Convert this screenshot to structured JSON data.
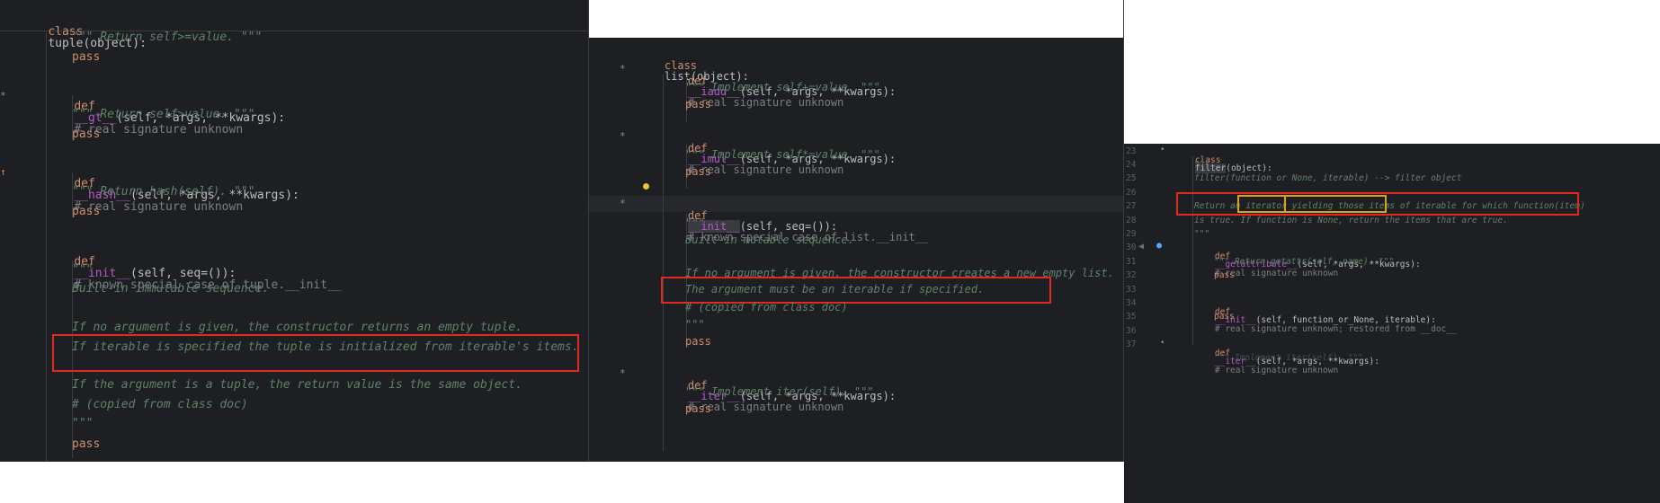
{
  "tuple_pane": {
    "lines": [
      {
        "k": "class",
        "n": "tuple",
        "r": "(object):"
      },
      {
        "doc": "\"\"\" Return self>=value. \"\"\""
      },
      {
        "pass": "pass"
      },
      {
        "def": "def",
        "name": "__gt__",
        "params": "(self, *args, **kwargs):",
        "comment": "# real signature unknown"
      },
      {
        "doc": "\"\"\" Return self>value. \"\"\""
      },
      {
        "pass": "pass"
      },
      {
        "def": "def",
        "name": "__hash__",
        "params": "(self, *args, **kwargs):",
        "comment": "# real signature unknown"
      },
      {
        "doc": "\"\"\" Return hash(self). \"\"\""
      },
      {
        "pass": "pass"
      },
      {
        "def": "def",
        "name": "__init__",
        "params": "(self, seq=()):",
        "comment": "# known special case of tuple.__init__"
      },
      {
        "doc": "\"\"\""
      },
      {
        "doc": "Built-in immutable sequence."
      },
      {
        "doc": "If no argument is given, the constructor returns an empty tuple."
      },
      {
        "doc": "If iterable is specified the tuple is initialized from iterable's items."
      },
      {
        "doc": "If the argument is a tuple, the return value is the same object."
      },
      {
        "doc": "# (copied from class doc)"
      },
      {
        "doc": "\"\"\""
      },
      {
        "pass": "pass"
      }
    ]
  },
  "list_pane": {
    "header": {
      "k": "class",
      "n": "list",
      "r": "(object):"
    },
    "lines": [
      {
        "def": "def",
        "name": "__iadd__",
        "params": "(self, *args, **kwargs):",
        "comment": "# real signature unknown"
      },
      {
        "doc": "\"\"\" Implement self+=value. \"\"\""
      },
      {
        "pass": "pass"
      },
      {
        "def": "def",
        "name": "__imul__",
        "params": "(self, *args, **kwargs):",
        "comment": "# real signature unknown"
      },
      {
        "doc": "\"\"\" Implement self*=value. \"\"\""
      },
      {
        "pass": "pass"
      },
      {
        "def": "def",
        "name": "__init__",
        "params": "(self, seq=()):",
        "comment": "# known special case of list.__init__"
      },
      {
        "doc": "\"\"\""
      },
      {
        "doc": "Built-in mutable sequence."
      },
      {
        "doc": "If no argument is given, the constructor creates a new empty list."
      },
      {
        "doc": "The argument must be an iterable if specified."
      },
      {
        "doc": "# (copied from class doc)"
      },
      {
        "doc": "\"\"\""
      },
      {
        "pass": "pass"
      },
      {
        "def": "def",
        "name": "__iter__",
        "params": "(self, *args, **kwargs):",
        "comment": "# real signature unknown"
      },
      {
        "doc": "\"\"\" Implement iter(self). \"\"\""
      },
      {
        "pass": "pass"
      }
    ]
  },
  "filter_pane": {
    "line_numbers": [
      "23",
      "24",
      "25",
      "26",
      "27",
      "28",
      "29",
      "30",
      "31",
      "32",
      "33",
      "34",
      "35",
      "36",
      "37"
    ],
    "header": {
      "k": "class",
      "n": "filter",
      "r": "(object):"
    },
    "lines": [
      {
        "doc": "\"\"\""
      },
      {
        "doc": "filter(function or None, iterable) --> filter object"
      },
      {
        "doc": "Return an iterator yielding those items of iterable for which function(item)"
      },
      {
        "doc": "is true. If function is None, return the items that are true."
      },
      {
        "doc": "\"\"\""
      },
      {
        "def": "def",
        "name": "__getattribute__",
        "params": "(self, *args, **kwargs):",
        "comment": "# real signature unknown"
      },
      {
        "doc": "\"\"\" Return getattr(self, name). \"\"\""
      },
      {
        "pass": "pass"
      },
      {
        "def": "def",
        "name": "__init__",
        "params": "(self, function_or_None, iterable):",
        "comment": "# real signature unknown; restored from __doc__"
      },
      {
        "pass": "pass"
      },
      {
        "def": "def",
        "name": "__iter__",
        "params": "(self, *args, **kwargs):",
        "comment": "# real signature unknown"
      },
      {
        "doc": "\"\"\" Implement iter(self). \"\"\""
      }
    ]
  },
  "colors": {
    "background": "#1e1f22",
    "keyword": "#cf8e6d",
    "dunder": "#b45ac6",
    "docstring": "#5f826b",
    "comment": "#7a7e85",
    "highlight_box": "#e2291f",
    "highlight_word_box": "#d8a31a"
  },
  "icons": [
    "intention-bulb-icon",
    "override-marker-icon",
    "implements-marker-icon",
    "fold-arrow-icon"
  ]
}
